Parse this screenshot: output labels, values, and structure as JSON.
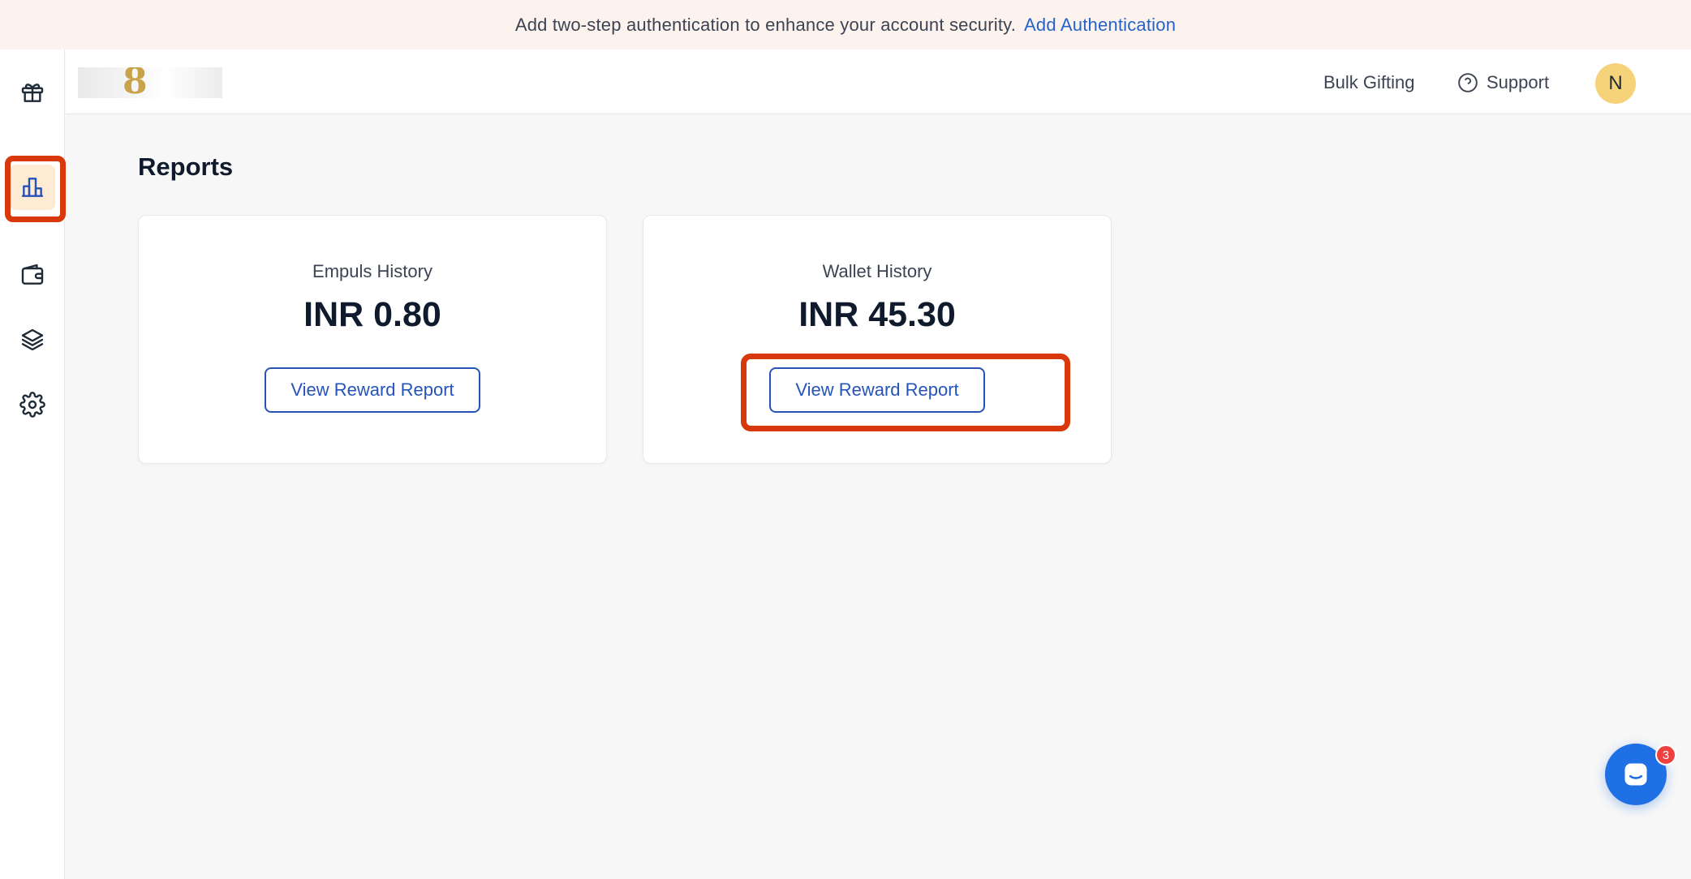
{
  "banner": {
    "message": "Add two-step authentication to enhance your account security.",
    "link_label": "Add Authentication"
  },
  "sidebar": {
    "items": [
      {
        "name": "gift-icon",
        "active": false
      },
      {
        "name": "bar-chart-icon",
        "active": true
      },
      {
        "name": "wallet-icon",
        "active": false
      },
      {
        "name": "layers-icon",
        "active": false
      },
      {
        "name": "gear-icon",
        "active": false
      }
    ]
  },
  "header": {
    "bulk_gifting_label": "Bulk Gifting",
    "support_label": "Support",
    "avatar_initial": "N"
  },
  "main": {
    "title": "Reports",
    "cards": [
      {
        "label": "Empuls History",
        "amount": "INR 0.80",
        "button_label": "View Reward Report"
      },
      {
        "label": "Wallet History",
        "amount": "INR 45.30",
        "button_label": "View Reward Report"
      }
    ]
  },
  "chat": {
    "badge_count": "3"
  },
  "colors": {
    "accent": "#2553b8",
    "highlight": "#d9370c",
    "banner_bg": "#fdf3ee",
    "avatar_bg": "#f6d27a",
    "chat_bg": "#1f6fe5"
  }
}
